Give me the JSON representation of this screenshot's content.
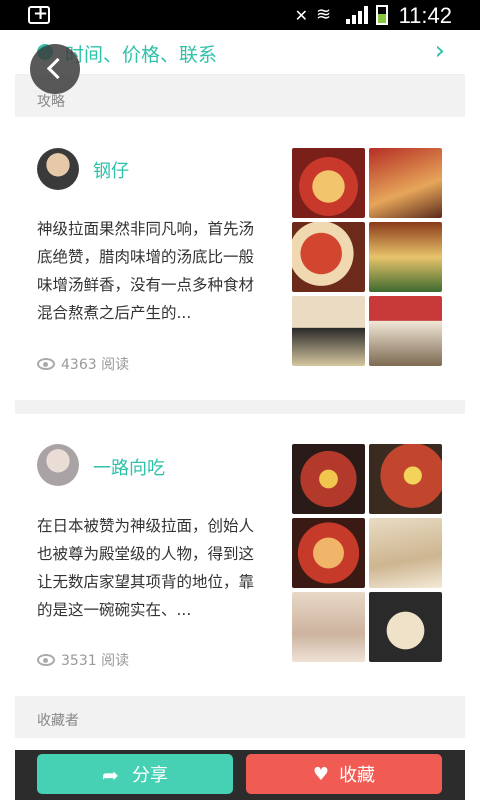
{
  "status_bar": {
    "time": "11:42",
    "icons": [
      "add-icon",
      "mute-vibrate-icon",
      "wifi-icon",
      "signal-icon",
      "battery-icon"
    ]
  },
  "info_row": {
    "label": "时间、价格、联系",
    "icon": "info-dot-icon",
    "chevron": "chevron-right-icon"
  },
  "sections": {
    "guides_label": "攻略",
    "collectors_label": "收藏者"
  },
  "posts": [
    {
      "username": "钢仔",
      "text": "神级拉面果然非同凡响，首先汤底绝赞，腊肉味增的汤底比一般味增汤鲜香，没有一点多种食材混合熬煮之后产生的...",
      "views": "4363 阅读"
    },
    {
      "username": "一路向吃",
      "text": "在日本被赞为神级拉面，创始人也被尊为殿堂级的人物，得到这让无数店家望其项背的地位，靠的是这一碗碗实在、...",
      "views": "3531 阅读"
    }
  ],
  "actions": {
    "share_label": "分享",
    "favorite_label": "收藏"
  },
  "colors": {
    "accent": "#2fc1a9",
    "share": "#47d1b4",
    "favorite": "#f05b54"
  }
}
